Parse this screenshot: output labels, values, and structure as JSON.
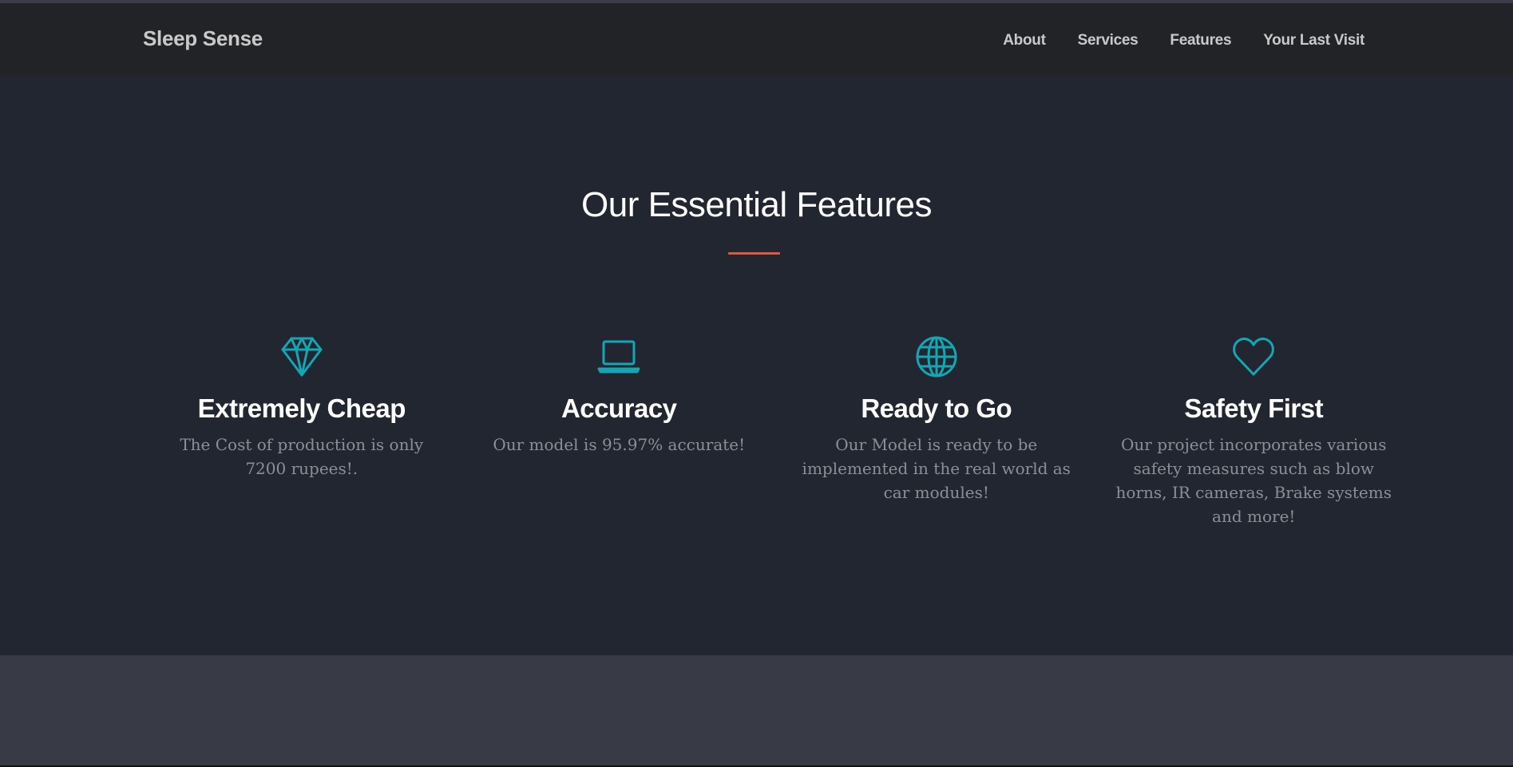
{
  "brand": "Sleep Sense",
  "nav": [
    {
      "label": "About"
    },
    {
      "label": "Services"
    },
    {
      "label": "Features"
    },
    {
      "label": "Your Last Visit"
    }
  ],
  "section": {
    "title": "Our Essential Features"
  },
  "features": [
    {
      "icon": "diamond-icon",
      "title": "Extremely Cheap",
      "text": "The Cost of production is only 7200 rupees!."
    },
    {
      "icon": "laptop-icon",
      "title": "Accuracy",
      "text": "Our model is 95.97% accurate!"
    },
    {
      "icon": "globe-icon",
      "title": "Ready to Go",
      "text": "Our Model is ready to be implemented in the real world as car modules!"
    },
    {
      "icon": "heart-icon",
      "title": "Safety First",
      "text": "Our project incorporates various safety measures such as blow horns, IR cameras, Brake systems and more!"
    }
  ],
  "colors": {
    "accent": "#14a6b3",
    "divider": "#e0593a",
    "navbar": "#212326",
    "section_bg": "#222630",
    "footer_bg": "#383b45"
  }
}
